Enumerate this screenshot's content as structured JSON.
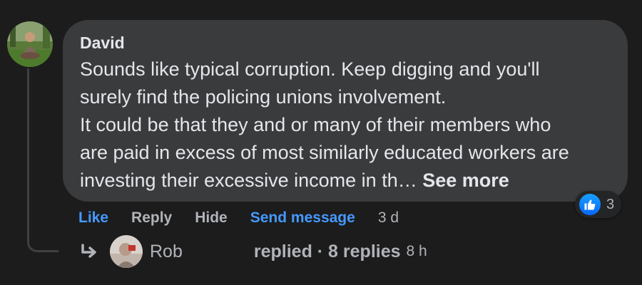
{
  "comment": {
    "author": "David",
    "text": "Sounds like typical corruption. Keep digging and you'll\nsurely find the policing unions involvement.\nIt could be that they and or many of their members who\nare paid in excess of most similarly educated workers are\ninvesting their excessive income in th… ",
    "see_more_label": "See more",
    "avatar_icon": "user-avatar-photo"
  },
  "reactions": {
    "type_icon": "like-icon",
    "count": "3",
    "color": "#0866ff"
  },
  "actions": {
    "like_label": "Like",
    "reply_label": "Reply",
    "hide_label": "Hide",
    "send_message_label": "Send message",
    "timestamp": "3 d"
  },
  "replies": {
    "arrow_icon": "reply-arrow-icon",
    "first_replier": "Rob",
    "summary": "replied · 8 replies",
    "timestamp": "8 h"
  },
  "colors": {
    "background": "#1c1c1d",
    "bubble": "#3a3b3c",
    "link_blue": "#4599ff",
    "muted_text": "#b0b3b8"
  }
}
